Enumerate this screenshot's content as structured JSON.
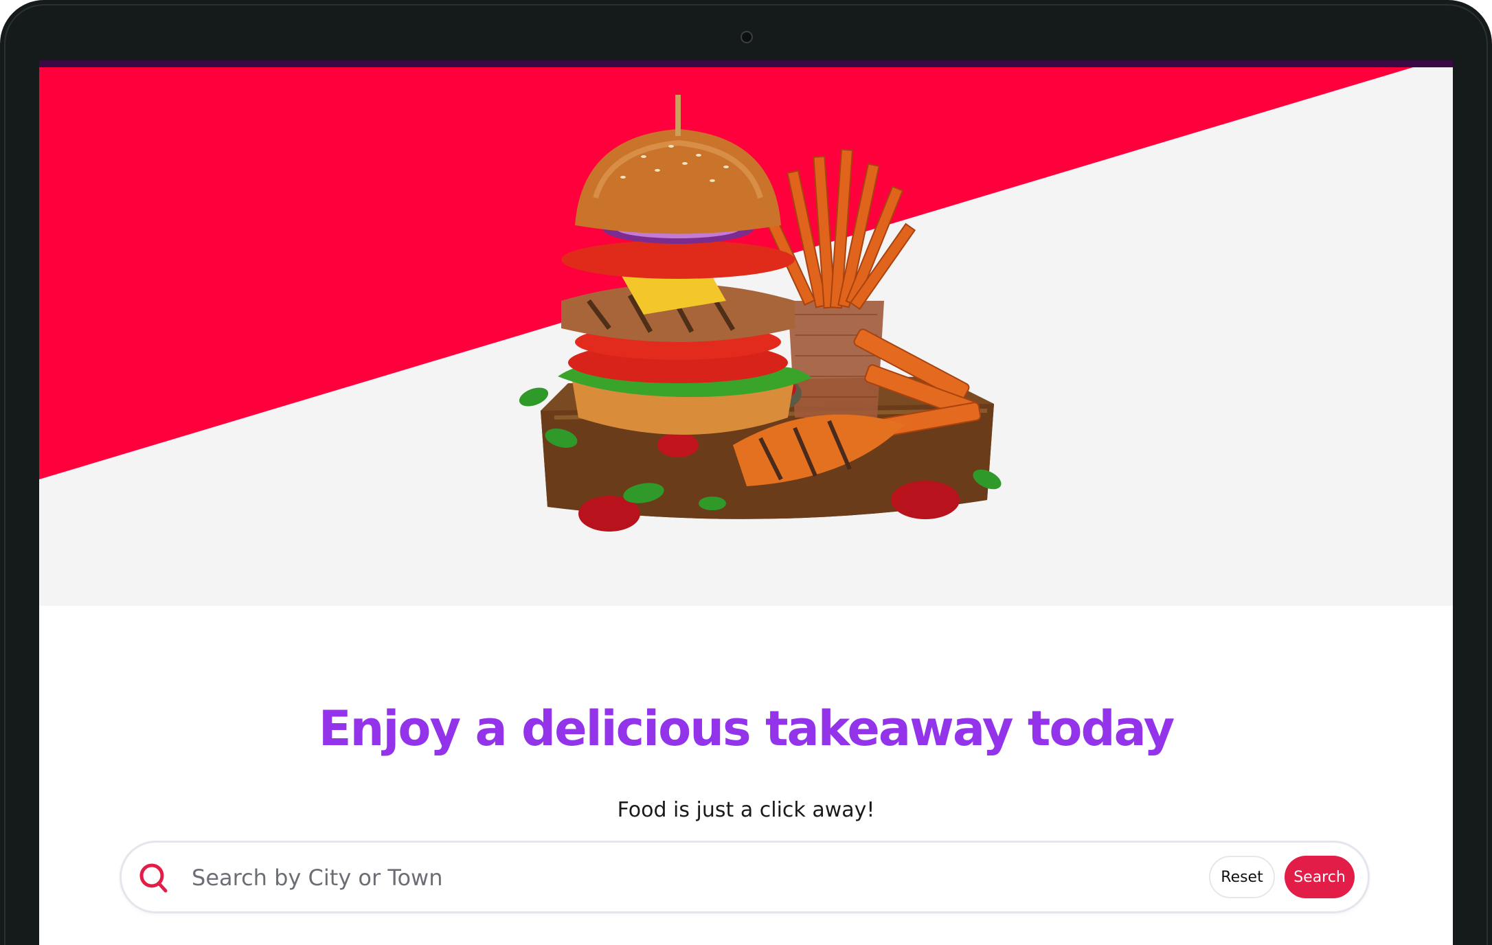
{
  "hero": {
    "image": "burger-and-fries-on-board",
    "colors": {
      "red_band": "#ff003c",
      "background": "#f4f4f5"
    }
  },
  "headline": "Enjoy a delicious takeaway today",
  "subheadline": "Food is just a click away!",
  "search": {
    "icon": "search-icon",
    "placeholder": "Search by City or Town",
    "value": "",
    "reset_label": "Reset",
    "submit_label": "Search"
  },
  "colors": {
    "headline": "#9333ea",
    "accent": "#e11d48"
  }
}
